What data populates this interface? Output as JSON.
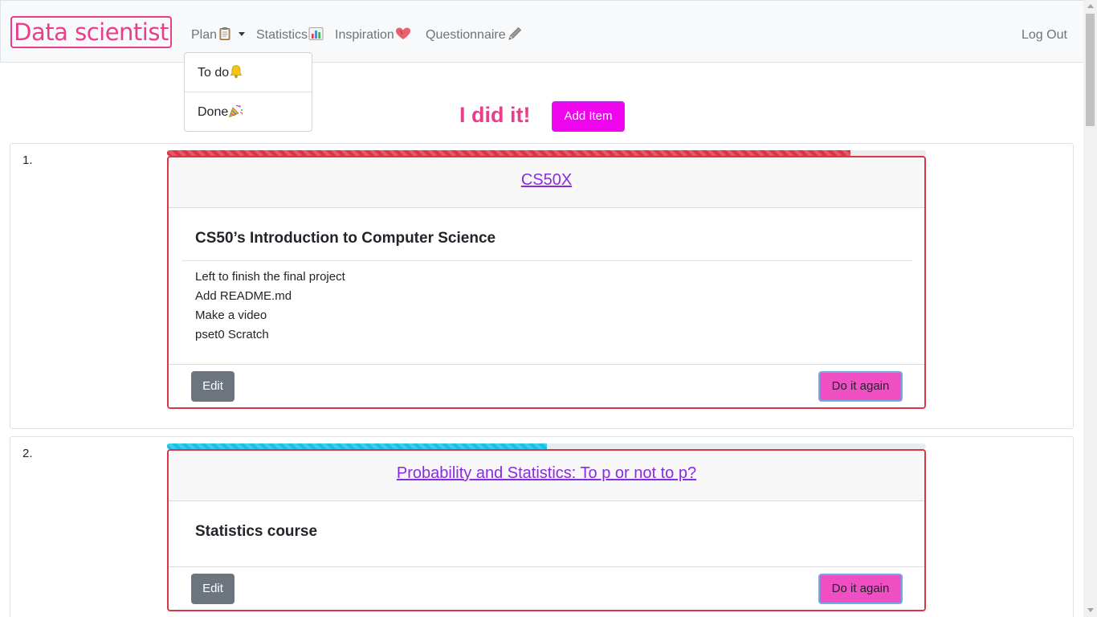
{
  "navbar": {
    "brand": "Data scientist",
    "items": [
      {
        "label": "Plan",
        "icon": "clipboard-icon"
      },
      {
        "label": "Statistics",
        "icon": "bar-chart-icon"
      },
      {
        "label": "Inspiration",
        "icon": "heart-icon"
      },
      {
        "label": "Questionnaire",
        "icon": "pencil-icon"
      }
    ],
    "logout": "Log Out"
  },
  "dropdown": {
    "items": [
      {
        "label": "To do",
        "icon": "bell-icon"
      },
      {
        "label": "Done",
        "icon": "party-popper-icon"
      }
    ]
  },
  "header": {
    "title": "I did it!",
    "add_button": "Add Item"
  },
  "colors": {
    "accent_pink": "#e83e8c",
    "add_button": "#ee05ee",
    "card_border": "#dc3545",
    "progress_red": "#dc3545",
    "progress_cyan": "#17c1e8",
    "link_purple": "#8a2be2",
    "again_button": "#f04fc4",
    "edit_button": "#6c757d"
  },
  "items": [
    {
      "number": "1.",
      "progress": 0.9,
      "link": "CS50X",
      "title": "CS50’s Introduction to Computer Science",
      "lines": [
        "Left to finish the final project",
        "Add README.md",
        "Make a video",
        "pset0 Scratch"
      ],
      "edit": "Edit",
      "again": "Do it again"
    },
    {
      "number": "2.",
      "progress": 0.5,
      "link": "Probability and Statistics: To p or not to p?",
      "title": "Statistics course",
      "edit": "Edit",
      "again": "Do it again"
    }
  ]
}
